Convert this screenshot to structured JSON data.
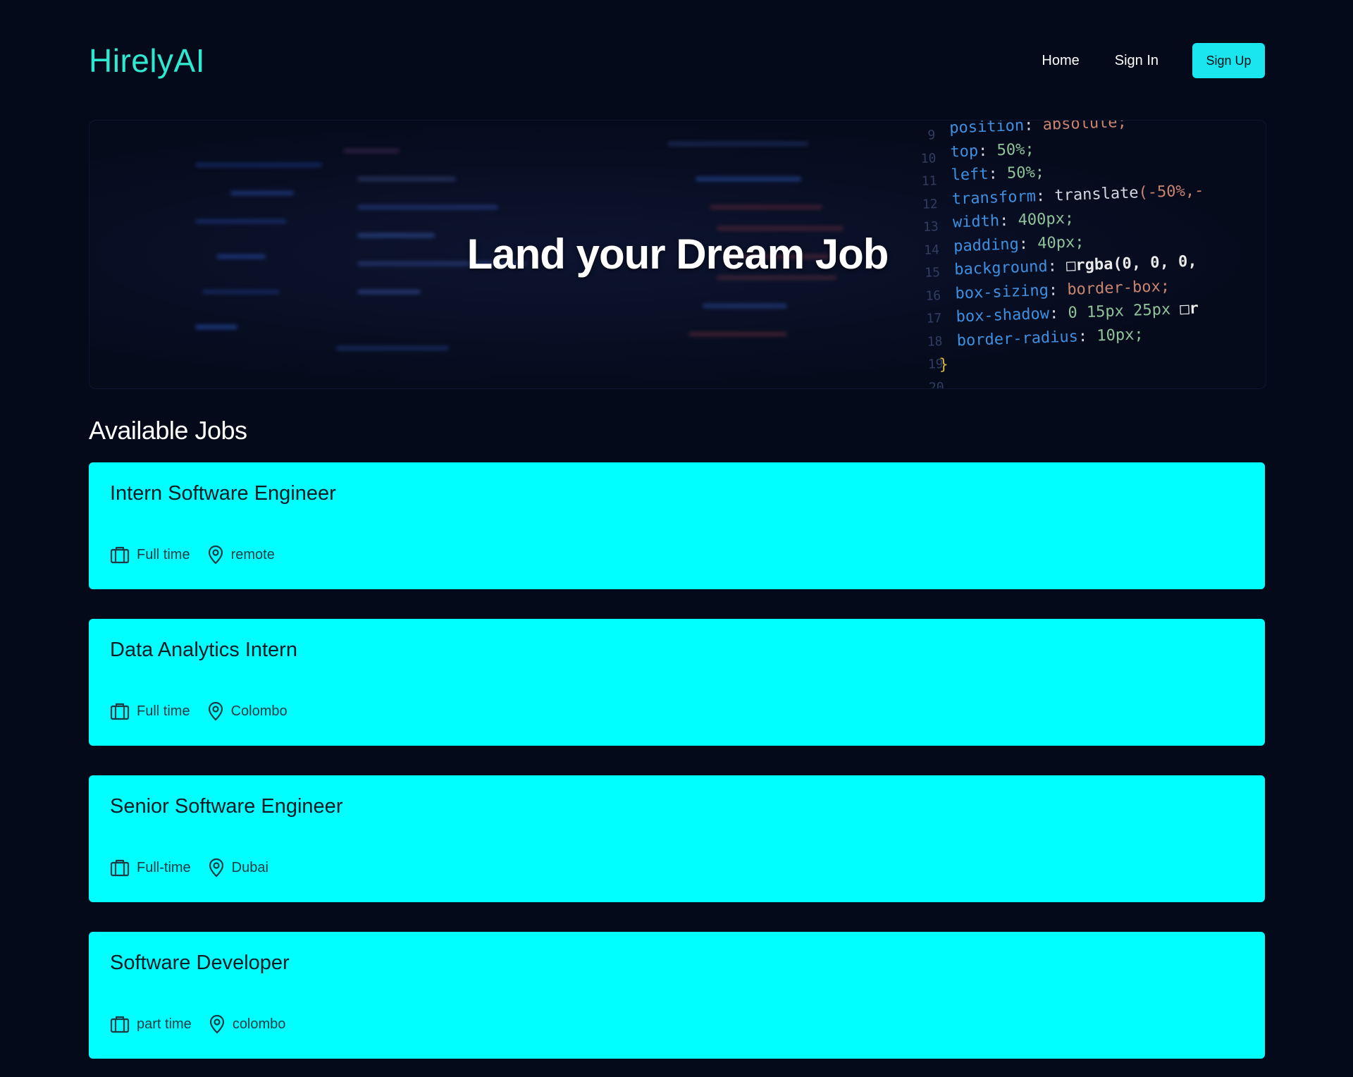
{
  "brand": "HirelyAI",
  "nav": {
    "home": "Home",
    "sign_in": "Sign In",
    "sign_up": "Sign Up"
  },
  "hero": {
    "title": "Land your Dream Job",
    "code_numbers": "9\n10\n11\n12\n13\n14\n15\n16\n17\n18\n19\n20"
  },
  "jobs_section": {
    "title": "Available Jobs",
    "icons": {
      "type": "briefcase-icon",
      "location": "map-pin-icon"
    },
    "card_color": "#00ffff",
    "items": [
      {
        "title": "Intern Software Engineer",
        "type": "Full time",
        "location": "remote"
      },
      {
        "title": "Data Analytics Intern",
        "type": "Full time",
        "location": "Colombo"
      },
      {
        "title": "Senior Software Engineer",
        "type": "Full-time",
        "location": "Dubai"
      },
      {
        "title": "Software Developer",
        "type": "part time",
        "location": "colombo"
      }
    ]
  },
  "colors": {
    "background": "#050a1a",
    "brand": "#2ee8cf",
    "accent_button": "#19e6ee"
  }
}
